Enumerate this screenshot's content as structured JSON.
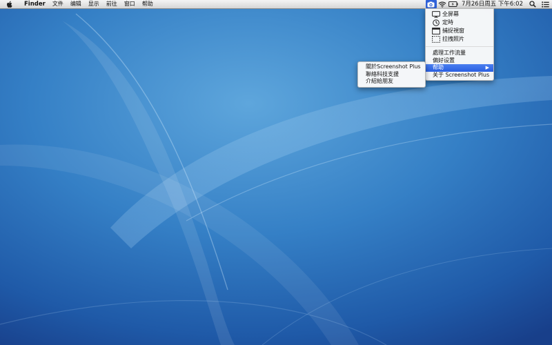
{
  "menubar": {
    "apple_icon": "apple-logo-icon",
    "app_name": "Finder",
    "items": [
      "文件",
      "编辑",
      "显示",
      "前往",
      "窗口",
      "帮助"
    ],
    "status_icons": [
      "screenshot-plus-camera-icon",
      "wifi-icon",
      "battery-icon"
    ],
    "clock": "7月26日周五 下午6:02",
    "right_icons": [
      "spotlight-search-icon",
      "notification-list-icon"
    ]
  },
  "main_menu": {
    "capture_items": [
      {
        "label": "全屏幕",
        "icon": "monitor-icon"
      },
      {
        "label": "定時",
        "icon": "timer-icon"
      },
      {
        "label": "捕捉視窗",
        "icon": "window-icon"
      },
      {
        "label": "拉拽照片",
        "icon": "selection-icon"
      }
    ],
    "items": [
      "處理工作流量",
      "偏好设置",
      "帮助",
      "关于 Screenshot Plus"
    ],
    "highlighted_index": 2
  },
  "help_submenu": {
    "items": [
      "關於Screenshot Plus",
      "聯絡科技支援",
      "介紹給朋友"
    ]
  },
  "colors": {
    "accent": "#2a5fe0",
    "desktop": "#2b6bb8"
  }
}
